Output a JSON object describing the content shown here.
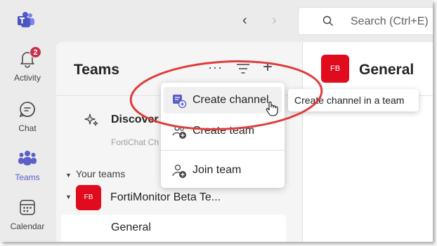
{
  "titlebar": {
    "search_placeholder": "Search (Ctrl+E)"
  },
  "rail": {
    "items": [
      {
        "label": "Activity",
        "icon": "bell-icon",
        "badge": "2"
      },
      {
        "label": "Chat",
        "icon": "chat-icon"
      },
      {
        "label": "Teams",
        "icon": "teams-icon",
        "active": true
      },
      {
        "label": "Calendar",
        "icon": "calendar-icon"
      }
    ]
  },
  "panel": {
    "title": "Teams",
    "more_label": "···",
    "discover_label": "Discover",
    "faded_text": "FortiChat Ch",
    "your_teams_label": "Your teams",
    "team": {
      "initials": "FB",
      "name": "FortiMonitor Beta Te..."
    },
    "channel": {
      "name": "General"
    }
  },
  "main": {
    "avatar_initials": "FB",
    "title": "General"
  },
  "menu": {
    "items": [
      {
        "label": "Create channel",
        "icon": "create-channel-icon"
      },
      {
        "label": "Create team",
        "icon": "create-team-icon"
      },
      {
        "label": "Join team",
        "icon": "join-team-icon"
      }
    ]
  },
  "tooltip": {
    "text": "Create channel in a team"
  },
  "colors": {
    "accent": "#5b5fc7",
    "badge": "#c4314b",
    "team_avatar": "#e00b1c",
    "annotation": "#e03c3c"
  }
}
